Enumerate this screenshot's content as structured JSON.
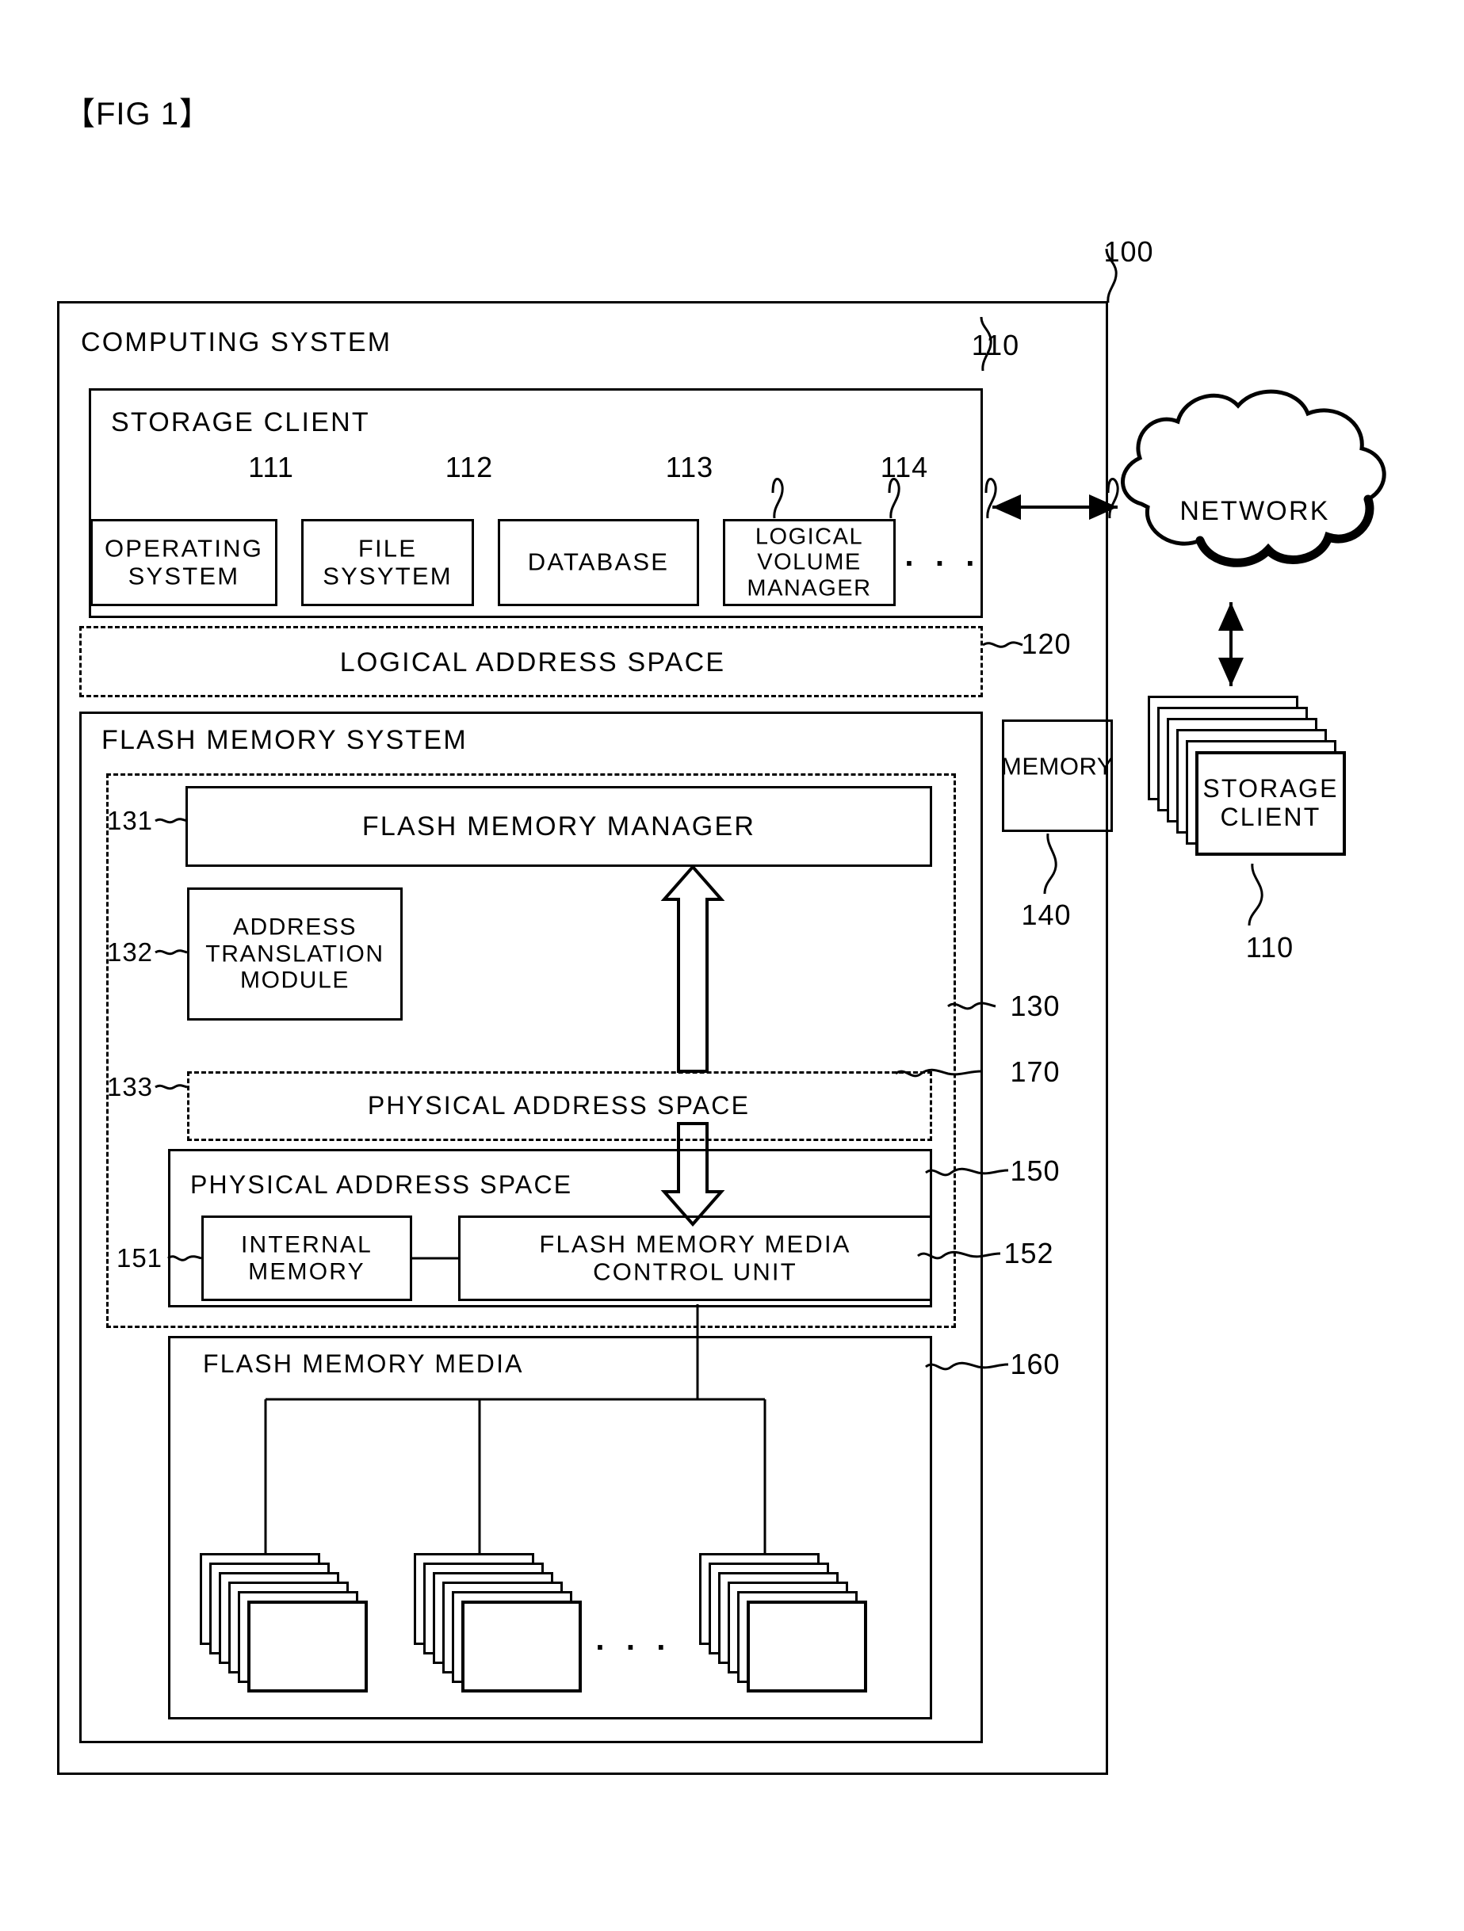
{
  "figure": {
    "title": "【FIG 1】"
  },
  "reference_numerals": {
    "system": "100",
    "storage_client": "110",
    "operating_system": "111",
    "file_system": "112",
    "database": "113",
    "logical_volume_manager": "114",
    "logical_address_space": "120",
    "flash_memory_system": "130",
    "flash_memory_manager": "131",
    "address_translation_module": "132",
    "physical_address_space_logical": "133",
    "memory": "140",
    "flash_memory_controller": "150",
    "internal_memory": "151",
    "flash_memory_media_control_unit": "152",
    "flash_memory_media": "160",
    "solid_state_storage_layer": "170",
    "remote_storage_client": "110"
  },
  "boxes": {
    "computing_system": "COMPUTING SYSTEM",
    "storage_client": "STORAGE CLIENT",
    "operating_system": "OPERATING\nSYSTEM",
    "file_system": "FILE\nSYSYTEM",
    "database": "DATABASE",
    "logical_volume_manager": "LOGICAL\nVOLUME\nMANAGER",
    "client_ellipsis": "· · ·",
    "logical_address_space": "LOGICAL ADDRESS SPACE",
    "flash_memory_system": "FLASH MEMORY SYSTEM",
    "flash_memory_manager": "FLASH MEMORY MANAGER",
    "address_translation_module": "ADDRESS\nTRANSLATION\nMODULE",
    "physical_address_space_upper": "PHYSICAL ADDRESS SPACE",
    "physical_address_space_lower": "PHYSICAL ADDRESS SPACE",
    "internal_memory": "INTERNAL\nMEMORY",
    "flash_memory_media_control_unit": "FLASH MEMORY MEDIA\nCONTROL UNIT",
    "flash_memory_media": "FLASH MEMORY MEDIA",
    "media_ellipsis": "· · ·",
    "memory": "MEMORY",
    "network": "NETWORK",
    "remote_storage_client": "STORAGE\nCLIENT"
  },
  "colors": {
    "stroke": "#000000",
    "background": "#ffffff"
  }
}
